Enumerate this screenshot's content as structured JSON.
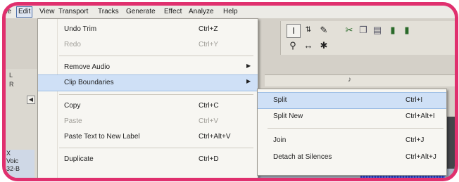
{
  "menubar": {
    "items": [
      "File",
      "Edit",
      "View",
      "Transport",
      "Tracks",
      "Generate",
      "Effect",
      "Analyze",
      "Help"
    ]
  },
  "edit_menu": {
    "items": [
      {
        "label": "Undo Trim",
        "shortcut": "Ctrl+Z",
        "disabled": false
      },
      {
        "label": "Redo",
        "shortcut": "Ctrl+Y",
        "disabled": true
      },
      {
        "label": "Remove Audio",
        "shortcut": "",
        "submenu": true
      },
      {
        "label": "Clip Boundaries",
        "shortcut": "",
        "submenu": true,
        "highlighted": true
      },
      {
        "label": "Copy",
        "shortcut": "Ctrl+C",
        "disabled": false
      },
      {
        "label": "Paste",
        "shortcut": "Ctrl+V",
        "disabled": true
      },
      {
        "label": "Paste Text to New Label",
        "shortcut": "Ctrl+Alt+V",
        "disabled": false
      },
      {
        "label": "Duplicate",
        "shortcut": "Ctrl+D",
        "disabled": false
      }
    ]
  },
  "submenu": {
    "items": [
      {
        "label": "Split",
        "shortcut": "Ctrl+I",
        "highlighted": true
      },
      {
        "label": "Split New",
        "shortcut": "Ctrl+Alt+I"
      },
      {
        "label": "Join",
        "shortcut": "Ctrl+J"
      },
      {
        "label": "Detach at Silences",
        "shortcut": "Ctrl+Alt+J"
      }
    ]
  },
  "toolbar": {
    "tools": [
      "I-beam-icon",
      "envelope-icon",
      "draw-icon",
      "zoom-icon",
      "timeshift-icon",
      "multi-tool-icon"
    ]
  },
  "left_panel": {
    "l_label": "L",
    "r_label": "R"
  },
  "track_info": {
    "close": "X",
    "name": "Voic",
    "rate": "32-B"
  },
  "colors": {
    "frame": "#e0306e",
    "highlight": "#cfe0f6",
    "waveform": "#2a3ed0"
  }
}
